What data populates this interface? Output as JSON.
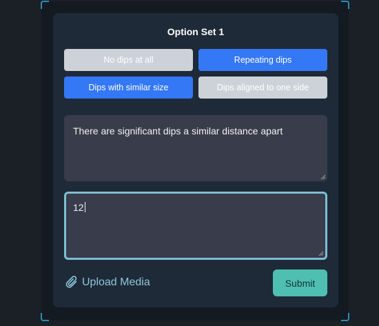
{
  "panel": {
    "title": "Option Set 1"
  },
  "options": [
    {
      "label": "No dips at all",
      "selected": false
    },
    {
      "label": "Repeating dips",
      "selected": true
    },
    {
      "label": "Dips with similar size",
      "selected": true
    },
    {
      "label": "Dips aligned to one side",
      "selected": false
    }
  ],
  "description_field": {
    "value": "There are significant dips a similar distance apart"
  },
  "answer_field": {
    "value": "12"
  },
  "upload": {
    "label": "Upload Media",
    "icon": "paperclip-icon"
  },
  "submit": {
    "label": "Submit"
  },
  "colors": {
    "selected": "#3478f6",
    "unselected": "#cdd2d9",
    "accent": "#4fbfb2",
    "focus_border": "#7cbfd2"
  }
}
